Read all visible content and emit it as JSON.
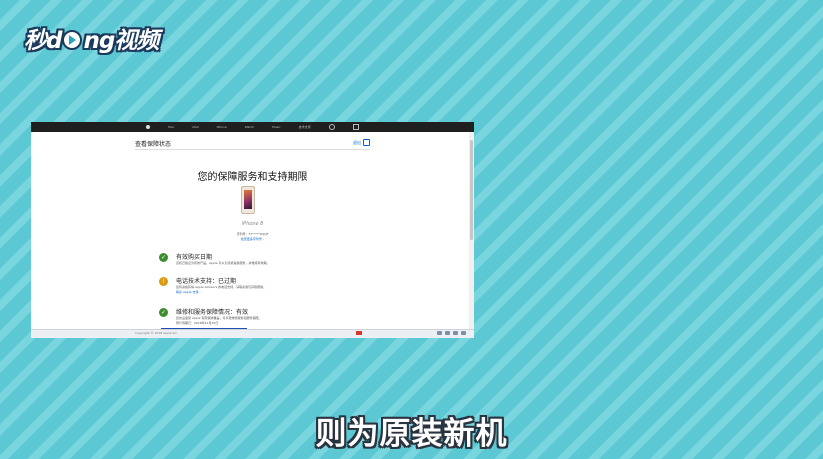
{
  "logo": {
    "prefix": "秒d",
    "suffix": "ng视频",
    "icon": "play-icon"
  },
  "apple_nav": {
    "items": [
      "Mac",
      "iPad",
      "iPhone",
      "Watch",
      "Music",
      "技术支持"
    ],
    "icons": [
      "apple-icon",
      "search-icon",
      "bag-icon"
    ]
  },
  "subhead": {
    "title": "查看保障状态",
    "right_link": "退出"
  },
  "page": {
    "title": "您的保障服务和支持期限",
    "device_name": "iPhone 8",
    "serial_line": "序列号：F7*****WJCJF",
    "serial_link": "检查更多序列号 ›"
  },
  "statuses": [
    {
      "icon": "check-icon",
      "state": "ok",
      "title": "有效购买日期",
      "desc": "该机已验证为有效产品。Apple 可以为该机提供服务，并维持有效期。"
    },
    {
      "icon": "warning-icon",
      "state": "warn",
      "title": "电话技术支持：已过期",
      "desc": "您有资格获得 Apple Advisors 的电话支持，请联系我们获取帮助。",
      "link": "联系 Apple 支持 ›"
    },
    {
      "icon": "check-icon",
      "state": "ok",
      "title": "维修和服务保障情况：有效",
      "desc": "您的设备受 Apple 有限保修覆盖，可享受维修服务和硬件保障。",
      "extra": "预计到期日：2018年12月25日"
    }
  ],
  "taskbar": {
    "left_text": "Copyright © 2018 Apple Inc."
  },
  "caption": "则为原装新机"
}
